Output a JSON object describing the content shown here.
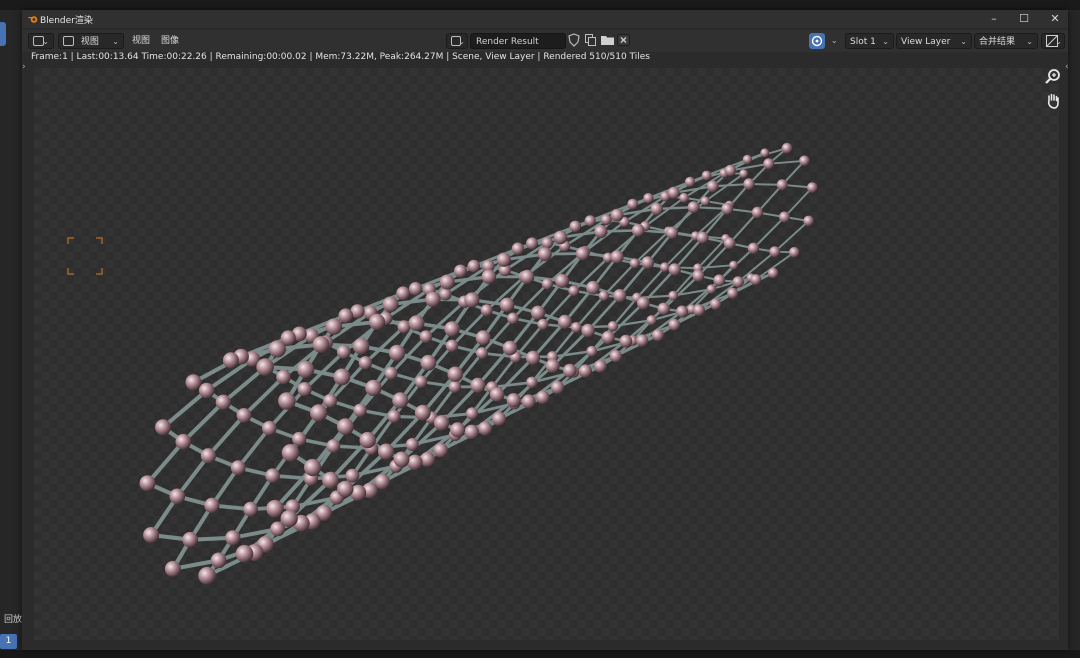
{
  "window": {
    "title": "Blender渲染",
    "minimize_glyph": "–",
    "maximize_glyph": "☐",
    "close_glyph": "✕"
  },
  "header": {
    "editor_icon": "image-editor-icon",
    "view_menu_icon_label": "视图",
    "menu_view": "视图",
    "menu_image": "图像",
    "image_name": "Render Result",
    "slot": "Slot 1",
    "view_layer": "View Layer",
    "pass": "合并结果"
  },
  "status": {
    "text": "Frame:1 | Last:00:13.64 Time:00:22.26 | Remaining:00:00.02 | Mem:73.22M, Peak:264.27M | Scene, View Layer | Rendered 510/510 Tiles"
  },
  "background": {
    "bottom_label": "回放",
    "frame_number": "1"
  },
  "colors": {
    "accent": "#4772b3",
    "atom": "#b08a93",
    "bond": "#7b8b8a",
    "crop_marker": "#d97a1a"
  },
  "render": {
    "subject": "nanotube-render",
    "rings": 12,
    "sections": 20
  }
}
